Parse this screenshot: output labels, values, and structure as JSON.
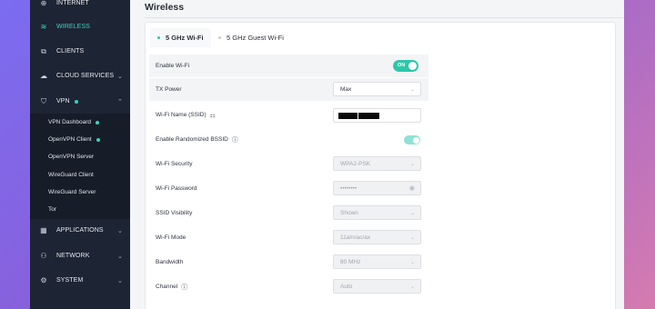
{
  "sidebar": {
    "items": [
      {
        "label": "INTERNET",
        "icon": "globe-icon",
        "glyph": "⊕"
      },
      {
        "label": "WIRELESS",
        "icon": "wifi-icon",
        "glyph": "≋"
      },
      {
        "label": "CLIENTS",
        "icon": "clients-icon",
        "glyph": "⧉"
      },
      {
        "label": "CLOUD SERVICES",
        "icon": "cloud-icon",
        "glyph": "☁"
      },
      {
        "label": "VPN",
        "icon": "shield-icon",
        "glyph": "⛉"
      },
      {
        "label": "APPLICATIONS",
        "icon": "apps-icon",
        "glyph": "▦"
      },
      {
        "label": "NETWORK",
        "icon": "network-icon",
        "glyph": "⚇"
      },
      {
        "label": "SYSTEM",
        "icon": "gear-icon",
        "glyph": "⚙"
      }
    ],
    "vpn_sub": [
      {
        "label": "VPN Dashboard"
      },
      {
        "label": "OpenVPN Client"
      },
      {
        "label": "OpenVPN Server"
      },
      {
        "label": "WireGuard Client"
      },
      {
        "label": "WireGuard Server"
      },
      {
        "label": "Tor"
      }
    ]
  },
  "main": {
    "title": "Wireless",
    "tabs": [
      {
        "label": "5 GHz Wi-Fi",
        "active": true
      },
      {
        "label": "5 GHz Guest Wi-Fi",
        "active": false
      }
    ],
    "settings": {
      "enable_wifi": {
        "label": "Enable Wi-Fi",
        "toggle_text": "ON"
      },
      "tx_power": {
        "label": "TX Power",
        "value": "Max"
      },
      "ssid": {
        "label": "Wi-Fi Name (SSID)"
      },
      "randomized_bssid": {
        "label": "Enable Randomized BSSID"
      },
      "security": {
        "label": "Wi-Fi Security",
        "value": "WPA2-PSK"
      },
      "password": {
        "label": "Wi-Fi Password",
        "value": "••••••••"
      },
      "ssid_visibility": {
        "label": "SSID Visibility",
        "value": "Shown"
      },
      "wifi_mode": {
        "label": "Wi-Fi Mode",
        "value": "11a/n/ac/ax"
      },
      "bandwidth": {
        "label": "Bandwidth",
        "value": "80 MHz"
      },
      "channel": {
        "label": "Channel",
        "value": "Auto"
      }
    }
  },
  "colors": {
    "accent": "#2ec7a7",
    "sidebar_bg": "#1d2433",
    "active_nav": "#3ad6c4"
  }
}
